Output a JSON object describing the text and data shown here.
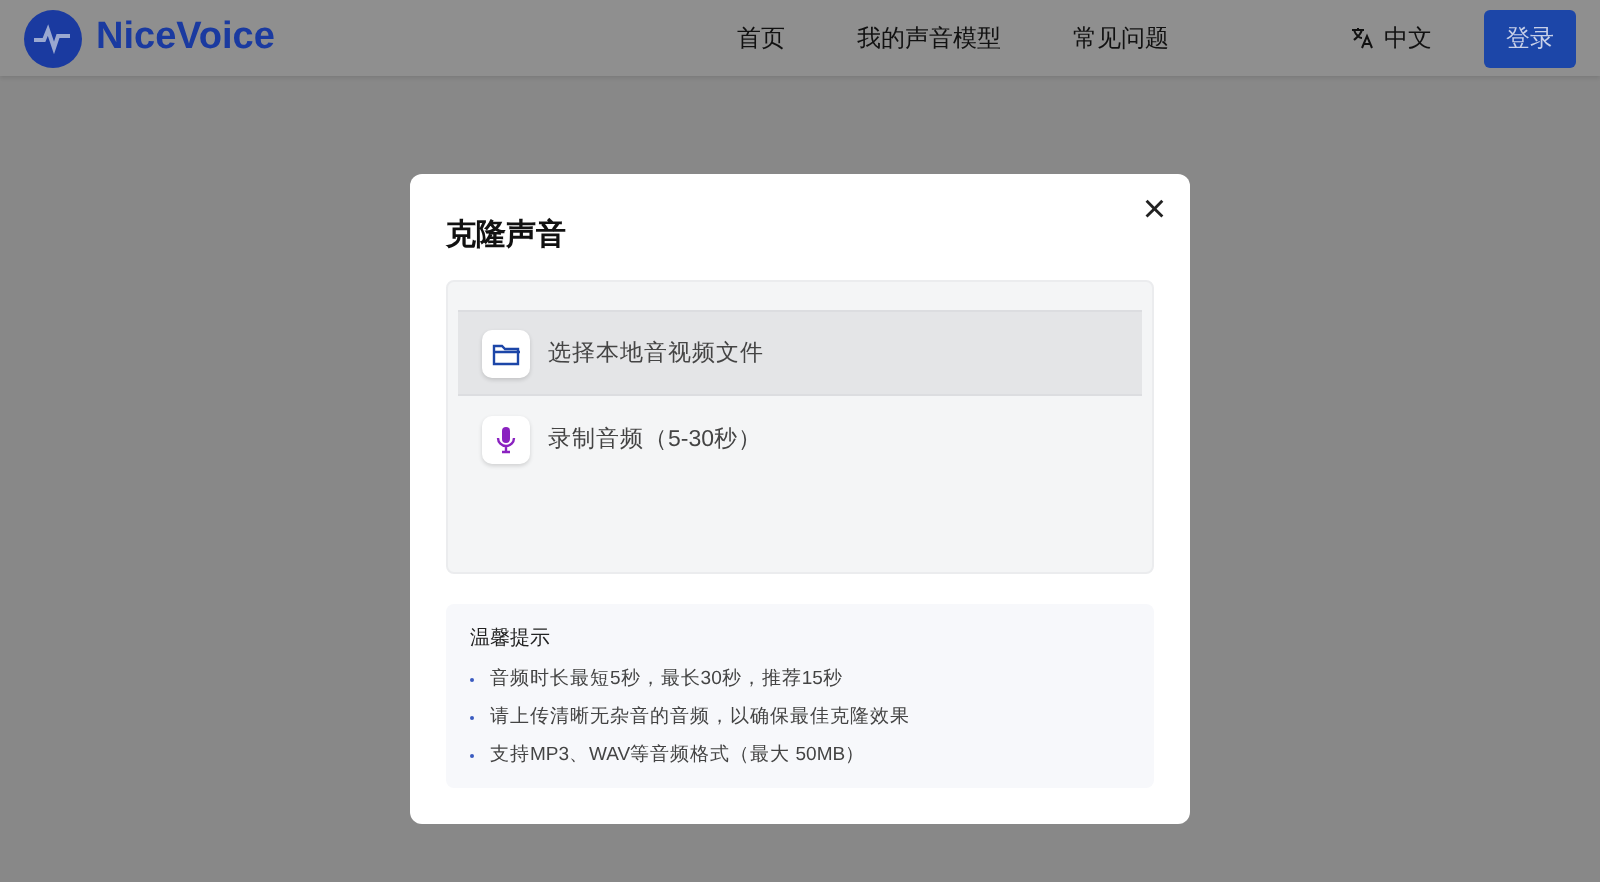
{
  "navbar": {
    "brand": "NiceVoice",
    "links": [
      "首页",
      "我的声音模型",
      "常见问题"
    ],
    "language": "中文",
    "login": "登录"
  },
  "dialog": {
    "title": "克隆声音",
    "close": "×",
    "options": [
      {
        "kind": "file",
        "label": "选择本地音视频文件",
        "selected": true
      },
      {
        "kind": "mic",
        "label": "录制音频（5-30秒）",
        "selected": false
      }
    ],
    "tips": {
      "title": "温馨提示",
      "items": [
        "音频时长最短5秒，最长30秒，推荐15秒",
        "请上传清晰无杂音的音频，以确保最佳克隆效果",
        "支持MP3、WAV等音频格式（最大 50MB）"
      ]
    }
  }
}
